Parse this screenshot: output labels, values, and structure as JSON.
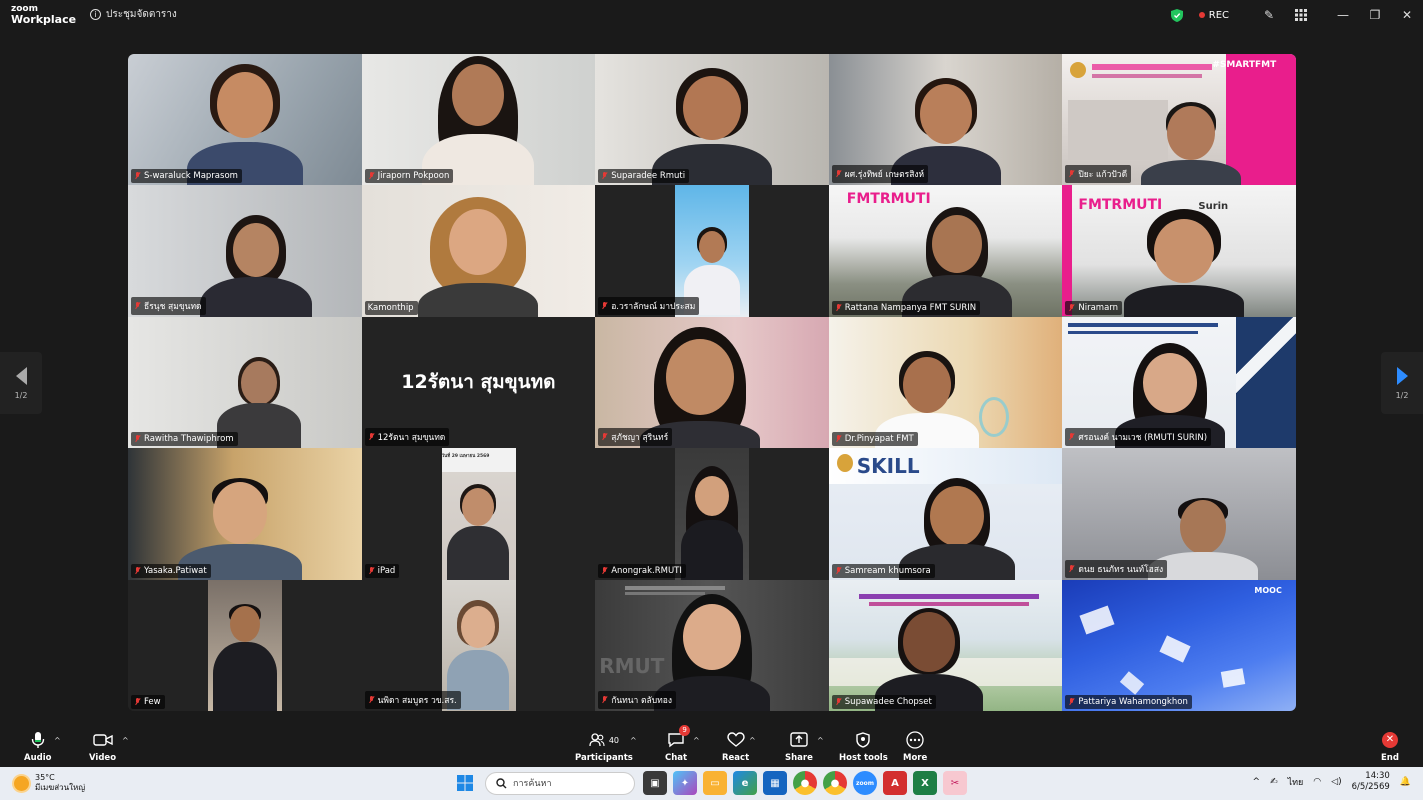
{
  "app": {
    "logo_line1": "zoom",
    "logo_line2": "Workplace",
    "meeting_label": "ประชุมจัดตาราง",
    "rec_label": "REC"
  },
  "colors": {
    "accent": "#2d8cff",
    "speaking": "#3ddc84",
    "mute": "#e53935"
  },
  "participants": [
    {
      "name": "S-waraluck Maprasom"
    },
    {
      "name": "Jiraporn Pokpoon"
    },
    {
      "name": "Suparadee Rmuti"
    },
    {
      "name": "ผศ.รุ่งทิพย์ เกษตรสิงห์"
    },
    {
      "name": "ปิยะ แก้วปัวดี"
    },
    {
      "name": "ธีรนุช สุมขุนทด"
    },
    {
      "name": "Kamonthip"
    },
    {
      "name": "อ.วราลักษณ์ มาประสม"
    },
    {
      "name": "Rattana Nampanya FMT SURIN"
    },
    {
      "name": "Niramarn"
    },
    {
      "name": "Rawitha Thawiphrom"
    },
    {
      "name": "12รัตนา สุมขุนทด",
      "display_text": "12รัตนา สุมขุนทด"
    },
    {
      "name": "สุภัชญา สุรินทร์"
    },
    {
      "name": "Dr.Pinyapat FMT"
    },
    {
      "name": "ศรอนงค์ นามเวช (RMUTI SURIN)"
    },
    {
      "name": "Yasaka.Patiwat"
    },
    {
      "name": "iPad"
    },
    {
      "name": "Anongrak.RMUTI"
    },
    {
      "name": "Samream khumsora"
    },
    {
      "name": "ดนย ธนภัทร นนท์โฮสง"
    },
    {
      "name": "Few"
    },
    {
      "name": "นพิดา สมบูตร วข.สร."
    },
    {
      "name": "กันทนา ตลับทอง"
    },
    {
      "name": "Supawadee Chopset"
    },
    {
      "name": "Pattariya Wahamongkhon"
    }
  ],
  "banners": {
    "fmt_rmuti_1": "FMTRMUTI",
    "fmt_rmuti_2": "FMTRMUTI",
    "surin": "Surin",
    "skill": "SKILL",
    "smartfmt": "#SMARTFMT",
    "rmut": "RMUT",
    "mooc": "MOOC",
    "ipad_date": "วันที่ 29 เมษายน 2569"
  },
  "pager": {
    "left_label": "1/2",
    "right_label": "1/2"
  },
  "toolbar": {
    "audio": "Audio",
    "video": "Video",
    "participants": "Participants",
    "participants_count": "40",
    "chat": "Chat",
    "chat_badge": "9",
    "react": "React",
    "share": "Share",
    "host_tools": "Host tools",
    "more": "More",
    "end": "End"
  },
  "taskbar": {
    "temperature": "35°C",
    "weather_desc": "มีเมฆส่วนใหญ่",
    "search_placeholder": "การค้นหา",
    "language": "ไทย",
    "time": "14:30",
    "date": "6/5/2569"
  }
}
